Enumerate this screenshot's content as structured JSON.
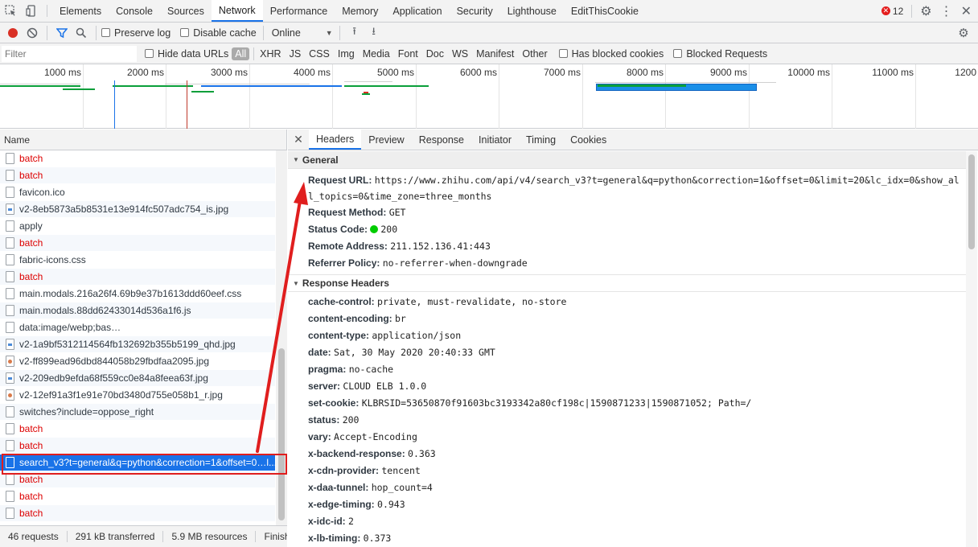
{
  "top_tabs": [
    "Elements",
    "Console",
    "Sources",
    "Network",
    "Performance",
    "Memory",
    "Application",
    "Security",
    "Lighthouse",
    "EditThisCookie"
  ],
  "active_tab": "Network",
  "error_count": "12",
  "toolbar": {
    "preserve_log": "Preserve log",
    "disable_cache": "Disable cache",
    "throttle": "Online"
  },
  "filter": {
    "placeholder": "Filter",
    "hide_data_urls": "Hide data URLs",
    "types": [
      "All",
      "XHR",
      "JS",
      "CSS",
      "Img",
      "Media",
      "Font",
      "Doc",
      "WS",
      "Manifest",
      "Other"
    ],
    "has_blocked_cookies": "Has blocked cookies",
    "blocked_requests": "Blocked Requests"
  },
  "overview": {
    "ticks": [
      "1000 ms",
      "2000 ms",
      "3000 ms",
      "4000 ms",
      "5000 ms",
      "6000 ms",
      "7000 ms",
      "8000 ms",
      "9000 ms",
      "10000 ms",
      "11000 ms",
      "1200"
    ]
  },
  "list": {
    "header": "Name",
    "rows": [
      {
        "name": "batch",
        "error": true,
        "icon": "file-icon"
      },
      {
        "name": "batch",
        "error": true,
        "icon": "file-icon"
      },
      {
        "name": "favicon.ico",
        "error": false,
        "icon": "file-icon"
      },
      {
        "name": "v2-8eb5873a5b8531e13e914fc507adc754_is.jpg",
        "error": false,
        "icon": "image-file-icon"
      },
      {
        "name": "apply",
        "error": false,
        "icon": "file-icon"
      },
      {
        "name": "batch",
        "error": true,
        "icon": "file-icon"
      },
      {
        "name": "fabric-icons.css",
        "error": false,
        "icon": "file-icon"
      },
      {
        "name": "batch",
        "error": true,
        "icon": "file-icon"
      },
      {
        "name": "main.modals.216a26f4.69b9e37b1613ddd60eef.css",
        "error": false,
        "icon": "file-icon"
      },
      {
        "name": "main.modals.88dd62433014d536a1f6.js",
        "error": false,
        "icon": "file-icon"
      },
      {
        "name": "data:image/webp;bas…",
        "error": false,
        "icon": "file-icon"
      },
      {
        "name": "v2-1a9bf5312114564fb132692b355b5199_qhd.jpg",
        "error": false,
        "icon": "image-file-icon"
      },
      {
        "name": "v2-ff899ead96dbd844058b29fbdfaa2095.jpg",
        "error": false,
        "icon": "image-file-icon"
      },
      {
        "name": "v2-209edb9efda68f559cc0e84a8feea63f.jpg",
        "error": false,
        "icon": "image-file-icon"
      },
      {
        "name": "v2-12ef91a3f1e91e70bd3480d755e058b1_r.jpg",
        "error": false,
        "icon": "image-file-icon"
      },
      {
        "name": "switches?include=oppose_right",
        "error": false,
        "icon": "file-icon"
      },
      {
        "name": "batch",
        "error": true,
        "icon": "file-icon"
      },
      {
        "name": "batch",
        "error": true,
        "icon": "file-icon"
      },
      {
        "name": "search_v3?t=general&q=python&correction=1&offset=0…l...",
        "error": false,
        "icon": "file-icon",
        "selected": true
      },
      {
        "name": "batch",
        "error": true,
        "icon": "file-icon"
      },
      {
        "name": "batch",
        "error": true,
        "icon": "file-icon"
      },
      {
        "name": "batch",
        "error": true,
        "icon": "file-icon"
      }
    ]
  },
  "status": {
    "requests": "46 requests",
    "transferred": "291 kB transferred",
    "resources": "5.9 MB resources",
    "finish": "Finish"
  },
  "detail_tabs": [
    "Headers",
    "Preview",
    "Response",
    "Initiator",
    "Timing",
    "Cookies"
  ],
  "general": {
    "title": "General",
    "request_url_label": "Request URL:",
    "request_url": "https://www.zhihu.com/api/v4/search_v3?t=general&q=python&correction=1&offset=0&limit=20&lc_idx=0&show_all_topics=0&time_zone=three_months",
    "request_method_label": "Request Method:",
    "request_method": "GET",
    "status_code_label": "Status Code:",
    "status_code": "200",
    "remote_address_label": "Remote Address:",
    "remote_address": "211.152.136.41:443",
    "referrer_policy_label": "Referrer Policy:",
    "referrer_policy": "no-referrer-when-downgrade"
  },
  "response_headers": {
    "title": "Response Headers",
    "items": [
      {
        "k": "cache-control:",
        "v": "private, must-revalidate, no-store"
      },
      {
        "k": "content-encoding:",
        "v": "br"
      },
      {
        "k": "content-type:",
        "v": "application/json"
      },
      {
        "k": "date:",
        "v": "Sat, 30 May 2020 20:40:33 GMT"
      },
      {
        "k": "pragma:",
        "v": "no-cache"
      },
      {
        "k": "server:",
        "v": "CLOUD ELB 1.0.0"
      },
      {
        "k": "set-cookie:",
        "v": "KLBRSID=53650870f91603bc3193342a80cf198c|1590871233|1590871052; Path=/"
      },
      {
        "k": "status:",
        "v": "200"
      },
      {
        "k": "vary:",
        "v": "Accept-Encoding"
      },
      {
        "k": "x-backend-response:",
        "v": "0.363"
      },
      {
        "k": "x-cdn-provider:",
        "v": "tencent"
      },
      {
        "k": "x-daa-tunnel:",
        "v": "hop_count=4"
      },
      {
        "k": "x-edge-timing:",
        "v": "0.943"
      },
      {
        "k": "x-idc-id:",
        "v": "2"
      },
      {
        "k": "x-lb-timing:",
        "v": "0.373"
      }
    ]
  },
  "colors": {
    "accent": "#1a73e8",
    "error_text": "#dd0000",
    "annotation": "#e01e1e"
  }
}
